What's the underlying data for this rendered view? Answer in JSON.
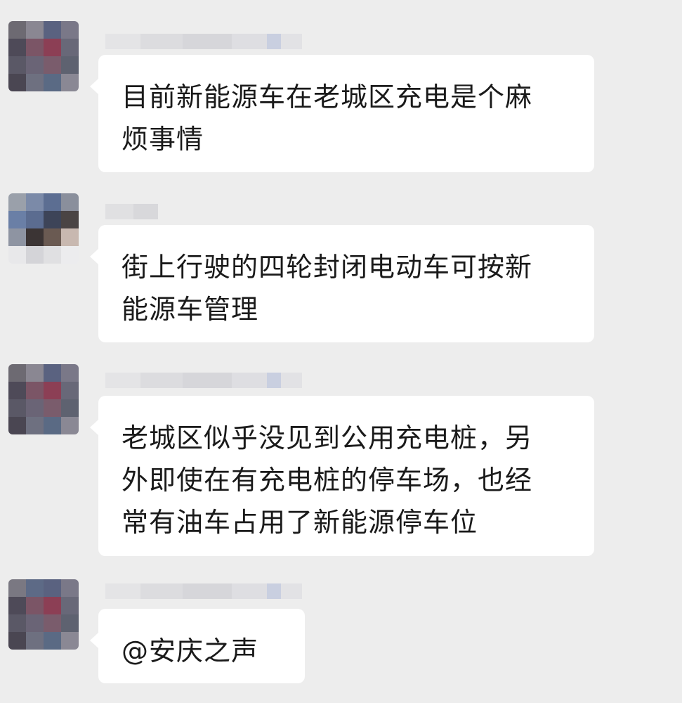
{
  "messages": [
    {
      "lines": [
        "目前新能源车在老城区充电是个麻",
        "烦事情"
      ]
    },
    {
      "lines": [
        "街上行驶的四轮封闭电动车可按新",
        "能源车管理"
      ]
    },
    {
      "lines": [
        "老城区似乎没见到公用充电桩，另",
        "外即使在有充电桩的停车场，也经",
        "常有油车占用了新能源停车位"
      ]
    },
    {
      "lines": [
        "@安庆之声"
      ]
    }
  ]
}
